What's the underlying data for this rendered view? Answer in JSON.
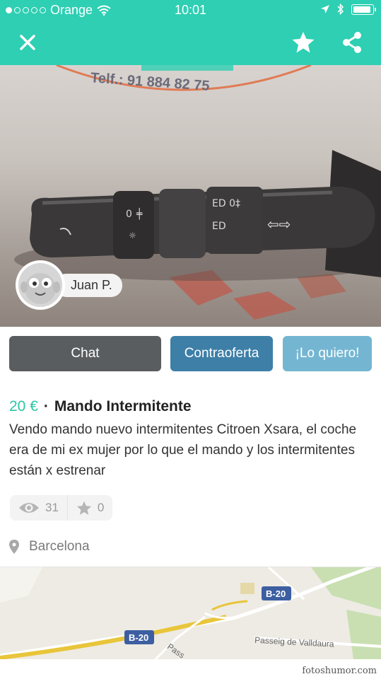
{
  "status_bar": {
    "carrier": "Orange",
    "time": "10:01",
    "signal_dots_filled": 1,
    "signal_dots_total": 5
  },
  "nav": {
    "close_icon": "close-icon",
    "favorite_icon": "star-icon",
    "share_icon": "share-icon"
  },
  "product_image": {
    "phone_text": "Telf.: 91 884 82 75"
  },
  "seller": {
    "name": "Juan P."
  },
  "actions": {
    "chat_label": "Chat",
    "offer_label": "Contraoferta",
    "buy_label": "¡Lo quiero!"
  },
  "listing": {
    "price": "20  €",
    "separator": "·",
    "title": "Mando Intermitente",
    "description": "Vendo mando nuevo intermitentes Citroen Xsara, el coche era de mi ex mujer por lo que el mando y los intermitentes están x estrenar"
  },
  "stats": {
    "views": "31",
    "favorites": "0"
  },
  "location": {
    "city": "Barcelona"
  },
  "map": {
    "road_label_1": "B-20",
    "road_label_2": "B-20",
    "street_1": "Passeig de Valldaura",
    "street_2": "Pass"
  },
  "watermark": "fotoshumor.com",
  "colors": {
    "header": "#2ecfb3",
    "price": "#2ec4a6",
    "chat_button": "#5a5d5f",
    "offer_button": "#3d7fa7",
    "buy_button": "#74b6d2"
  }
}
